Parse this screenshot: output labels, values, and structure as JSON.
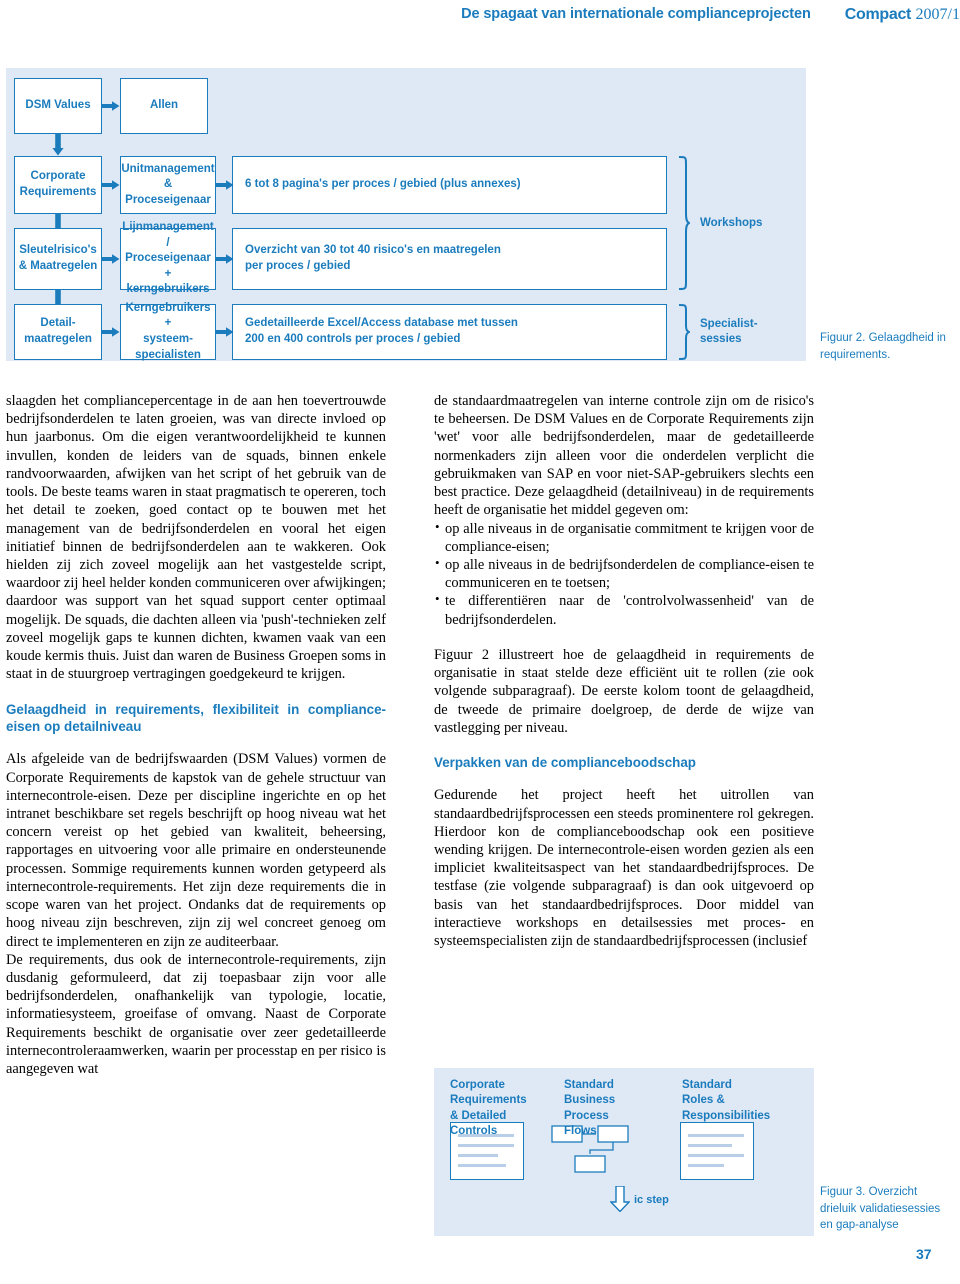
{
  "running_head": {
    "article_title": "De spagaat van internationale complianceprojecten",
    "journal_name": "Compact",
    "issue": "2007/1"
  },
  "figure2": {
    "caption": "Figuur 2. Gelaagdheid in requirements.",
    "column1": [
      {
        "label": "DSM Values"
      },
      {
        "label": "Corporate\nRequirements"
      },
      {
        "label": "Sleutelrisico's\n& Maatregelen"
      },
      {
        "label": "Detail-\nmaatregelen"
      }
    ],
    "column2": [
      {
        "label": "Allen"
      },
      {
        "label": "Unitmanagement\n& Proceseigenaar"
      },
      {
        "label": "Lijnmanagement /\nProceseigenaar +\nkerngebruikers"
      },
      {
        "label": "Kerngebruikers +\nsysteem-\nspecialisten"
      }
    ],
    "column3": [
      {
        "label": "6 tot 8 pagina's per proces / gebied (plus annexes)"
      },
      {
        "label": "Overzicht van 30 tot 40 risico's en maatregelen\nper proces / gebied"
      },
      {
        "label": "Gedetailleerde Excel/Access database met tussen\n200 en 400 controls per proces / gebied"
      }
    ],
    "brackets": [
      {
        "label": "Workshops"
      },
      {
        "label": "Specialist-\nsessies"
      }
    ]
  },
  "body": {
    "left_column": {
      "paragraphs": [
        "slaagden het compliancepercentage in de aan hen toevertrouwde bedrijfsonderdelen te laten groeien, was van directe invloed op hun jaarbonus. Om die eigen verantwoordelijkheid te kunnen invullen, konden de leiders van de squads, binnen enkele randvoorwaarden, afwijken van het script of het gebruik van de tools. De beste teams waren in staat pragmatisch te opereren, toch het detail te zoeken, goed contact op te bouwen met het management van de bedrijfsonderdelen en vooral het eigen initiatief binnen de bedrijfsonderdelen aan te wakkeren. Ook hielden zij zich zoveel mogelijk aan het vastgestelde script, waardoor zij heel helder konden communiceren over afwijkingen; daardoor was support van het squad support center optimaal mogelijk. De squads, die dachten alleen via 'push'-technieken zelf zoveel mogelijk gaps te kunnen dichten, kwamen vaak van een koude kermis thuis. Juist dan waren de Business Groepen soms in staat in de stuurgroep vertragingen goedgekeurd te krijgen."
      ],
      "subhead": "Gelaagdheid in requirements, flexibiliteit in compliance-eisen op detailniveau",
      "paragraphs_after": [
        "Als afgeleide van de bedrijfswaarden (DSM Values) vormen de Corporate Requirements de kapstok van de gehele structuur van internecontrole-eisen. Deze per discipline ingerichte en op het intranet beschikbare set regels beschrijft op hoog niveau wat het concern vereist op het gebied van kwaliteit, beheersing, rapportages en uitvoering voor alle primaire en ondersteunende processen. Sommige requirements kunnen worden getypeerd als internecontrole-requirements. Het zijn deze requirements die in scope waren van het project. Ondanks dat de requirements op hoog niveau zijn beschreven, zijn zij wel concreet genoeg om direct te implementeren en zijn ze auditeerbaar.",
        "De requirements, dus ook de internecontrole-requirements, zijn dusdanig geformuleerd, dat zij toepasbaar zijn voor alle bedrijfsonderdelen, onafhankelijk van typologie, locatie, informatiesysteem, groeifase of omvang. Naast de Corporate Requirements beschikt de organisatie over zeer gedetailleerde internecontroleraamwerken, waarin per processtap en per risico is aangegeven wat"
      ]
    },
    "right_column": {
      "paragraphs": [
        "de standaardmaatregelen van interne controle zijn om de risico's te beheersen. De DSM Values en de Corporate Requirements zijn 'wet' voor alle bedrijfsonderdelen, maar de gedetailleerde normenkaders zijn alleen voor die onderdelen verplicht die gebruikmaken van SAP en voor niet-SAP-gebruikers slechts een best practice. Deze gelaagdheid (detailniveau) in de requirements heeft de organisatie het middel gegeven om:"
      ],
      "bullets": [
        "op alle niveaus in de organisatie commitment te krijgen voor de compliance-eisen;",
        "op alle niveaus in de bedrijfsonderdelen de compliance-eisen te communiceren en te toetsen;",
        "te differentiëren naar de 'controlvolwassenheid' van de bedrijfsonderdelen."
      ],
      "paragraphs_after_bullets": [
        "Figuur 2 illustreert hoe de gelaagdheid in requirements de organisatie in staat stelde deze efficiënt uit te rollen (zie ook volgende subparagraaf). De eerste kolom toont de gelaagdheid, de tweede de primaire doelgroep, de derde de wijze van vastlegging per niveau."
      ],
      "subhead": "Verpakken van de complianceboodschap",
      "paragraphs_after_subhead": [
        "Gedurende het project heeft het uitrollen van standaardbedrijfsprocessen een steeds prominentere rol gekregen. Hierdoor kon de complianceboodschap ook een positieve wending krijgen. De internecontrole-eisen worden gezien als een impliciet kwaliteitsaspect van het standaardbedrijfsproces. De testfase (zie volgende subparagraaf) is dan ook uitgevoerd op basis van het standaardbedrijfsproces. Door middel van interactieve workshops en detailsessies met proces- en systeemspecialisten zijn de standaardbedrijfsprocessen (inclusief"
      ]
    }
  },
  "figure3": {
    "labels": [
      "Corporate\nRequirements\n& Detailed\nControls",
      "Standard\nBusiness\nProcess\nFlows",
      "Standard\nRoles &\nResponsibilities"
    ],
    "ic_step": "ic step",
    "caption": "Figuur 3. Overzicht drieluik validatiesessies en gap-analyse"
  },
  "folio": {
    "page_number": "37"
  },
  "colors": {
    "brand_blue": "#1b7cbd",
    "diagram_bg": "#dfe8f5",
    "box_fill": "#ffffff"
  }
}
